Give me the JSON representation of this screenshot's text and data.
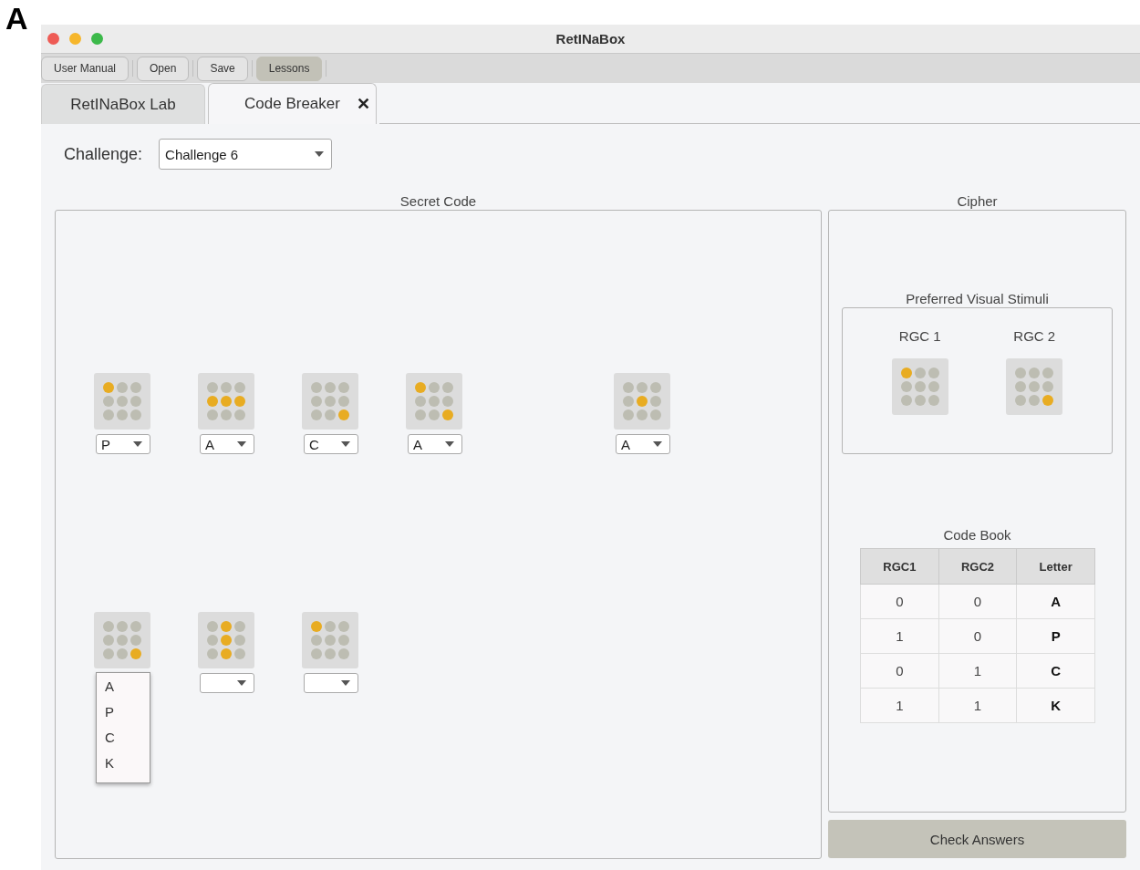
{
  "panel_label": "A",
  "window": {
    "title": "RetINaBox"
  },
  "toolbar": [
    {
      "label": "User Manual",
      "selected": false
    },
    {
      "label": "Open",
      "selected": false
    },
    {
      "label": "Save",
      "selected": false
    },
    {
      "label": "Lessons",
      "selected": true
    }
  ],
  "tabs": [
    {
      "label": "RetINaBox Lab",
      "selected": false
    },
    {
      "label": "Code Breaker",
      "selected": true,
      "close_icon": "✕"
    }
  ],
  "challenge": {
    "label": "Challenge:",
    "value": "Challenge 6"
  },
  "secret_code": {
    "title": "Secret Code",
    "rows": [
      [
        {
          "kind": "stimulus",
          "dots": [
            true,
            false,
            false,
            false,
            false,
            false,
            false,
            false,
            false
          ],
          "value": "P"
        },
        {
          "kind": "stimulus",
          "dots": [
            false,
            false,
            false,
            true,
            true,
            true,
            false,
            false,
            false
          ],
          "value": "A"
        },
        {
          "kind": "stimulus",
          "dots": [
            false,
            false,
            false,
            false,
            false,
            false,
            false,
            false,
            true
          ],
          "value": "C"
        },
        {
          "kind": "stimulus",
          "dots": [
            true,
            false,
            false,
            false,
            false,
            false,
            false,
            false,
            true
          ],
          "value": "A"
        },
        {
          "kind": "blank"
        },
        {
          "kind": "stimulus",
          "dots": [
            false,
            false,
            false,
            false,
            true,
            false,
            false,
            false,
            false
          ],
          "value": "A"
        }
      ],
      [
        {
          "kind": "open",
          "dots": [
            false,
            false,
            false,
            false,
            false,
            false,
            false,
            false,
            true
          ],
          "options": [
            "A",
            "P",
            "C",
            "K"
          ]
        },
        {
          "kind": "stimulus",
          "dots": [
            false,
            true,
            false,
            false,
            true,
            false,
            false,
            true,
            false
          ]
        },
        {
          "kind": "stimulus",
          "dots": [
            true,
            false,
            false,
            false,
            false,
            false,
            false,
            false,
            false
          ]
        }
      ]
    ]
  },
  "cipher": {
    "title": "Cipher",
    "preferred": {
      "title": "Preferred Visual Stimuli",
      "cells": [
        {
          "label": "RGC 1",
          "dots": [
            true,
            false,
            false,
            false,
            false,
            false,
            false,
            false,
            false
          ]
        },
        {
          "label": "RGC 2",
          "dots": [
            false,
            false,
            false,
            false,
            false,
            false,
            false,
            false,
            true
          ]
        }
      ]
    },
    "code_book": {
      "title": "Code Book",
      "columns": [
        "RGC1",
        "RGC2",
        "Letter"
      ],
      "rows": [
        [
          "0",
          "0",
          "A"
        ],
        [
          "1",
          "0",
          "P"
        ],
        [
          "0",
          "1",
          "C"
        ],
        [
          "1",
          "1",
          "K"
        ]
      ]
    }
  },
  "check_button": "Check Answers"
}
